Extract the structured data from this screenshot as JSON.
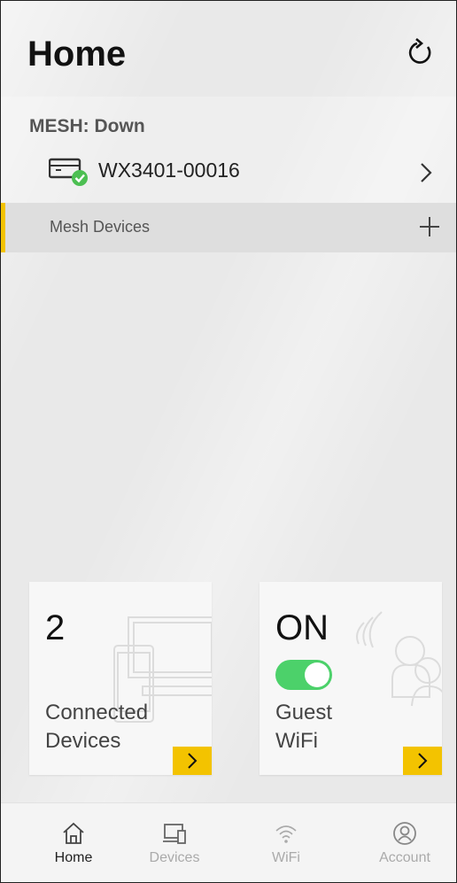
{
  "header": {
    "title": "Home",
    "refresh_icon": "refresh-icon"
  },
  "mesh": {
    "status": "MESH: Down",
    "router": {
      "name": "WX3401-00016",
      "icon": "router-connected-icon"
    },
    "devices_label": "Mesh Devices",
    "accent_color": "#f3c300"
  },
  "cards": {
    "connected": {
      "count": "2",
      "label_line1": "Connected",
      "label_line2": "Devices"
    },
    "guest": {
      "state": "ON",
      "toggle_on": true,
      "label_line1": "Guest",
      "label_line2": "WiFi",
      "toggle_color": "#4cd16a"
    }
  },
  "tabs": [
    {
      "label": "Home",
      "icon": "home-icon",
      "active": true
    },
    {
      "label": "Devices",
      "icon": "devices-icon",
      "active": false
    },
    {
      "label": "WiFi",
      "icon": "wifi-icon",
      "active": false
    },
    {
      "label": "Account",
      "icon": "account-icon",
      "active": false
    }
  ]
}
